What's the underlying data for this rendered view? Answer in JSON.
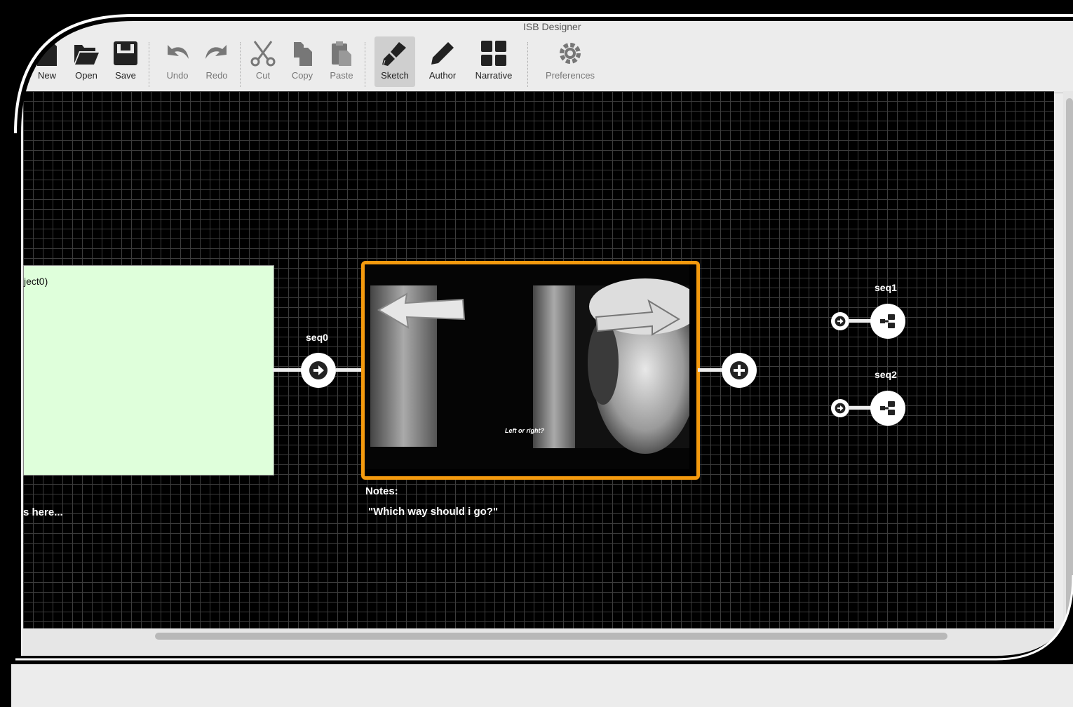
{
  "window": {
    "title": "ISB Designer"
  },
  "toolbar": {
    "new": "New",
    "open": "Open",
    "save": "Save",
    "undo": "Undo",
    "redo": "Redo",
    "cut": "Cut",
    "copy": "Copy",
    "paste": "Paste",
    "sketch": "Sketch",
    "author": "Author",
    "narrative": "Narrative",
    "preferences": "Preferences"
  },
  "canvas": {
    "green_node": {
      "text": "ject0)",
      "notes": "s here..."
    },
    "seq0": {
      "label": "seq0"
    },
    "video_node": {
      "subtitle": "Left or right?",
      "notes_title": "Notes:",
      "notes_text": "\"Which way should i go?\""
    },
    "seq1": {
      "label": "seq1"
    },
    "seq2": {
      "label": "seq2"
    }
  },
  "colors": {
    "selection": "#f49a0e",
    "green_node": "#dfffdb",
    "canvas": "#000000"
  }
}
